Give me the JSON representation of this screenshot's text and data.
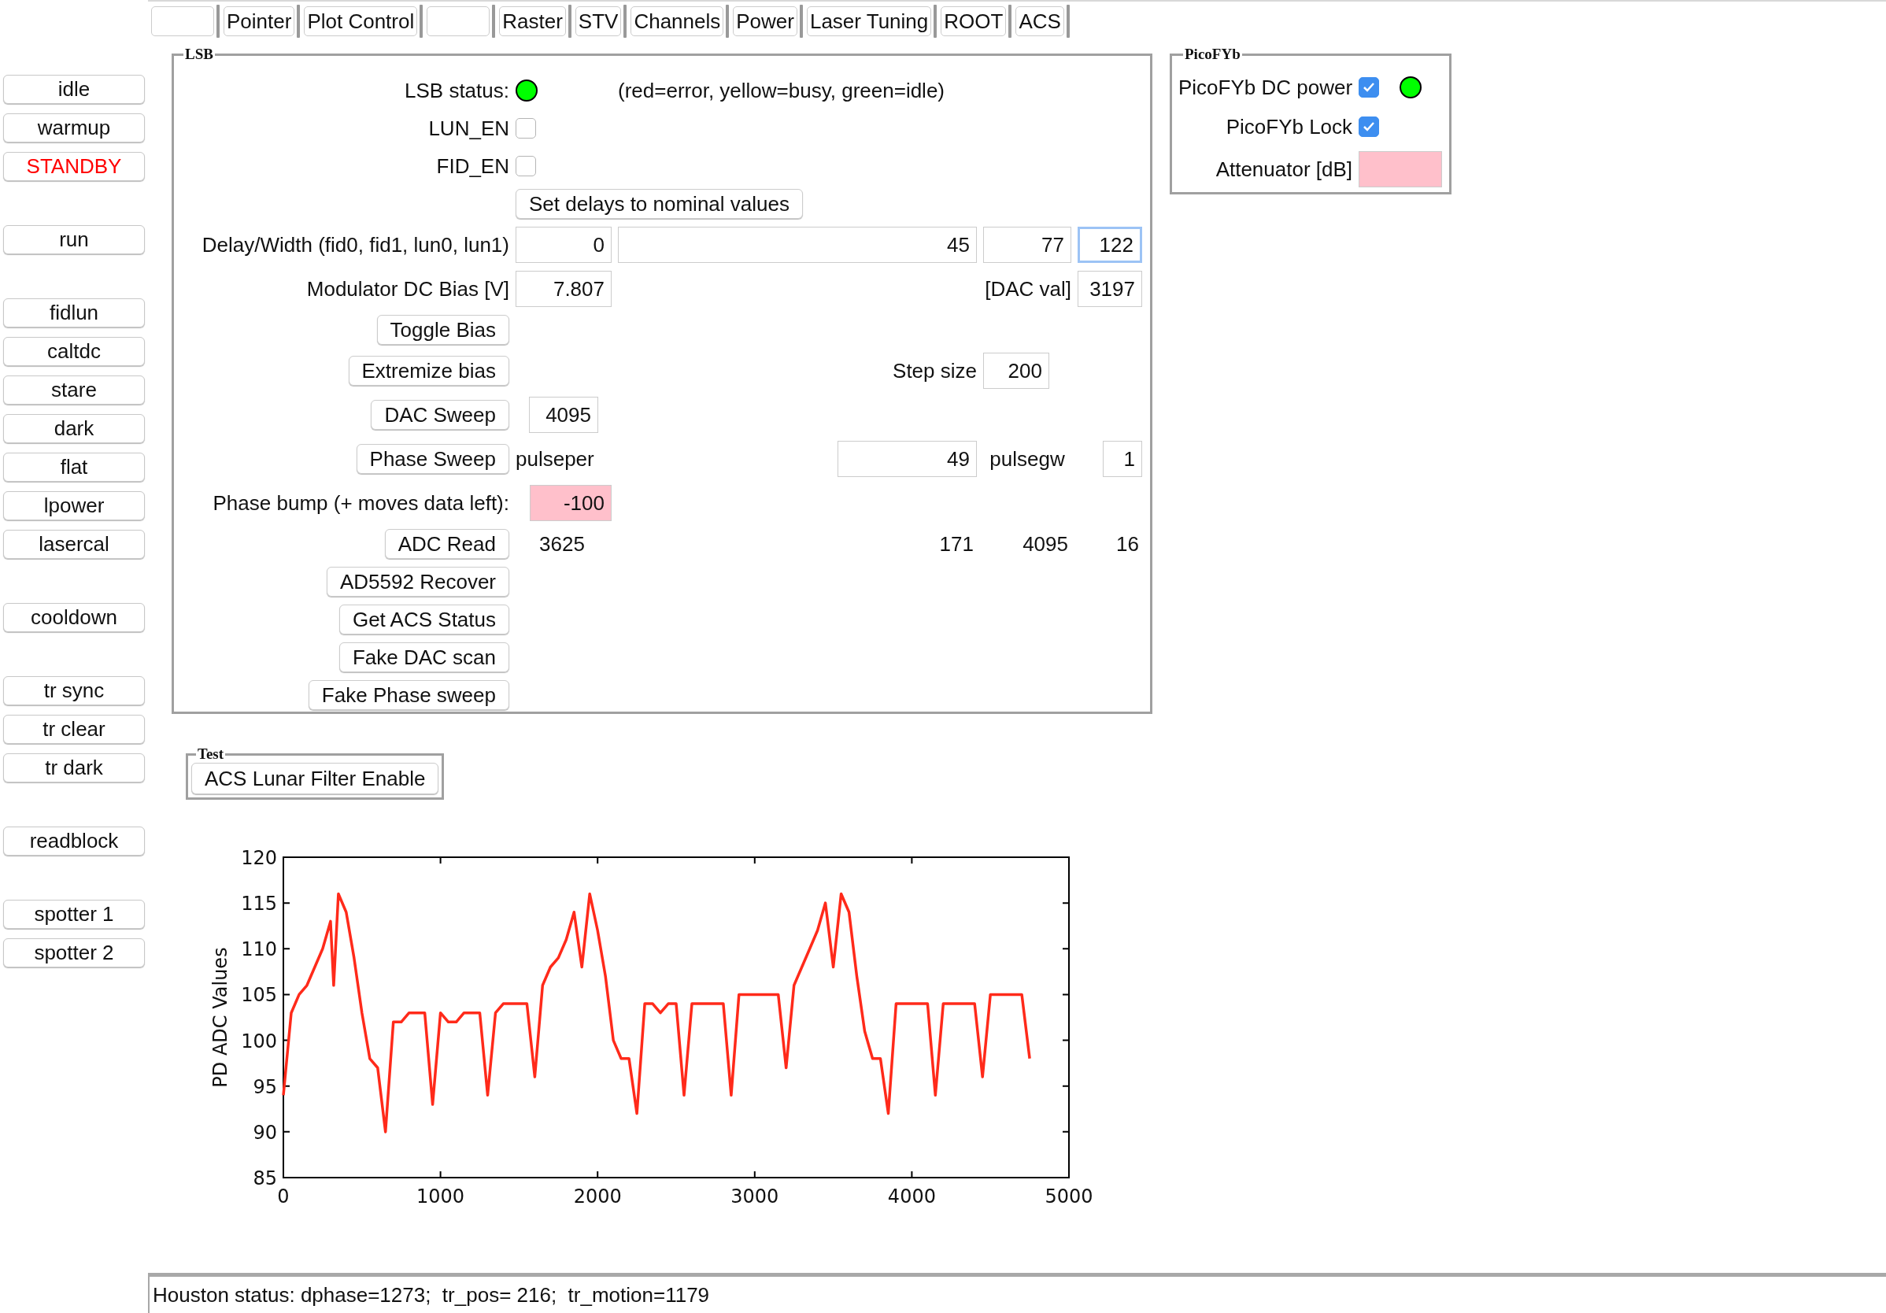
{
  "tabs": [
    {
      "kind": "blank"
    },
    {
      "kind": "text",
      "label": "Pointer"
    },
    {
      "kind": "text",
      "label": "Plot Control"
    },
    {
      "kind": "blank"
    },
    {
      "kind": "text",
      "label": "Raster"
    },
    {
      "kind": "text",
      "label": "STV"
    },
    {
      "kind": "text",
      "label": "Channels"
    },
    {
      "kind": "text",
      "label": "Power"
    },
    {
      "kind": "text",
      "label": "Laser Tuning"
    },
    {
      "kind": "text",
      "label": "ROOT"
    },
    {
      "kind": "text",
      "label": "ACS"
    }
  ],
  "sidebar": {
    "groups": [
      [
        {
          "label": "idle",
          "alert": false
        },
        {
          "label": "warmup",
          "alert": false
        },
        {
          "label": "STANDBY",
          "alert": true
        }
      ],
      [
        {
          "label": "run",
          "alert": false
        }
      ],
      [
        {
          "label": "fidlun",
          "alert": false
        },
        {
          "label": "caltdc",
          "alert": false
        },
        {
          "label": "stare",
          "alert": false
        },
        {
          "label": "dark",
          "alert": false
        },
        {
          "label": "flat",
          "alert": false
        },
        {
          "label": "lpower",
          "alert": false
        },
        {
          "label": "lasercal",
          "alert": false
        }
      ],
      [
        {
          "label": "cooldown",
          "alert": false
        }
      ],
      [
        {
          "label": "tr sync",
          "alert": false
        },
        {
          "label": "tr clear",
          "alert": false
        },
        {
          "label": "tr dark",
          "alert": false
        }
      ],
      [
        {
          "label": "readblock",
          "alert": false
        }
      ],
      [
        {
          "label": "spotter 1",
          "alert": false
        },
        {
          "label": "spotter 2",
          "alert": false
        }
      ]
    ]
  },
  "lsb": {
    "legend": "LSB",
    "status": {
      "label": "LSB status:",
      "color": "#00ff00",
      "note": "(red=error, yellow=busy, green=idle)"
    },
    "lun_en": {
      "label": "LUN_EN",
      "checked": false
    },
    "fid_en": {
      "label": "FID_EN",
      "checked": false
    },
    "set_delays_button": "Set delays to nominal values",
    "delay_width": {
      "label": "Delay/Width (fid0, fid1, lun0, lun1)",
      "fields": [
        {
          "value": "0",
          "focused": false
        },
        {
          "value": "45",
          "focused": false
        },
        {
          "value": "77",
          "focused": false
        },
        {
          "value": "122",
          "focused": true
        }
      ]
    },
    "bias": {
      "label": "Modulator DC Bias [V]",
      "value": "7.807",
      "dac_label": "[DAC val]",
      "dac_value": "3197"
    },
    "toggle_bias_button": "Toggle Bias",
    "extremize": {
      "button": "Extremize bias",
      "step_label": "Step size",
      "step_value": "200"
    },
    "dac_sweep": {
      "button": "DAC Sweep",
      "value": "4095"
    },
    "phase_sweep": {
      "button": "Phase Sweep",
      "pulseper_label": "pulseper",
      "pulseper_value": "49",
      "pulsegw_label": "pulsegw",
      "pulsegw_value": "1"
    },
    "phase_bump": {
      "label": "Phase bump (+ moves data left):",
      "value": "-100",
      "invalid": true
    },
    "adc_read": {
      "button": "ADC Read",
      "readings": [
        "3625",
        "171",
        "4095",
        "16"
      ]
    },
    "buttons": [
      "AD5592 Recover",
      "Get ACS Status",
      "Fake DAC scan",
      "Fake Phase sweep"
    ]
  },
  "picofyb": {
    "legend": "PicoFYb",
    "dc_power": {
      "label": "PicoFYb DC power",
      "checked": true,
      "color": "#00ff00"
    },
    "lock": {
      "label": "PicoFYb Lock",
      "checked": true
    },
    "attenuator": {
      "label": "Attenuator [dB]",
      "invalid": true
    }
  },
  "test": {
    "legend": "Test",
    "button": "ACS Lunar Filter Enable"
  },
  "chart_data": {
    "type": "line",
    "ylabel": "PD ADC Values",
    "xlim": [
      0,
      5000
    ],
    "ylim": [
      85,
      120
    ],
    "xticks": [
      0,
      1000,
      2000,
      3000,
      4000,
      5000
    ],
    "yticks": [
      85,
      90,
      95,
      100,
      105,
      110,
      115,
      120
    ],
    "x": [
      0,
      50,
      100,
      150,
      200,
      250,
      300,
      320,
      350,
      400,
      450,
      500,
      550,
      600,
      650,
      700,
      750,
      800,
      850,
      900,
      950,
      1000,
      1050,
      1100,
      1150,
      1200,
      1250,
      1300,
      1350,
      1400,
      1450,
      1500,
      1550,
      1600,
      1650,
      1700,
      1750,
      1800,
      1850,
      1900,
      1950,
      2000,
      2050,
      2100,
      2150,
      2200,
      2250,
      2300,
      2350,
      2400,
      2450,
      2500,
      2550,
      2600,
      2650,
      2700,
      2750,
      2800,
      2850,
      2900,
      2950,
      3000,
      3050,
      3100,
      3150,
      3200,
      3250,
      3300,
      3350,
      3400,
      3450,
      3500,
      3550,
      3600,
      3650,
      3700,
      3750,
      3800,
      3850,
      3900,
      3950,
      4000,
      4050,
      4100,
      4150,
      4200,
      4250,
      4300,
      4350,
      4400,
      4450,
      4500,
      4550,
      4600,
      4650,
      4700,
      4750
    ],
    "series": [
      {
        "color": "#ff2a1a",
        "values": [
          94,
          103,
          105,
          106,
          108,
          110,
          113,
          106,
          116,
          114,
          109,
          103,
          98,
          97,
          90,
          102,
          102,
          103,
          103,
          103,
          93,
          103,
          102,
          102,
          103,
          103,
          103,
          94,
          103,
          104,
          104,
          104,
          104,
          96,
          106,
          108,
          109,
          111,
          114,
          108,
          116,
          112,
          107,
          100,
          98,
          98,
          92,
          104,
          104,
          103,
          104,
          104,
          94,
          104,
          104,
          104,
          104,
          104,
          94,
          105,
          105,
          105,
          105,
          105,
          105,
          97,
          106,
          108,
          110,
          112,
          115,
          108,
          116,
          114,
          107,
          101,
          98,
          98,
          92,
          104,
          104,
          104,
          104,
          104,
          94,
          104,
          104,
          104,
          104,
          104,
          96,
          105,
          105,
          105,
          105,
          105,
          98
        ]
      }
    ]
  },
  "status_bar": "Houston status: dphase=1273;  tr_pos= 216;  tr_motion=1179"
}
